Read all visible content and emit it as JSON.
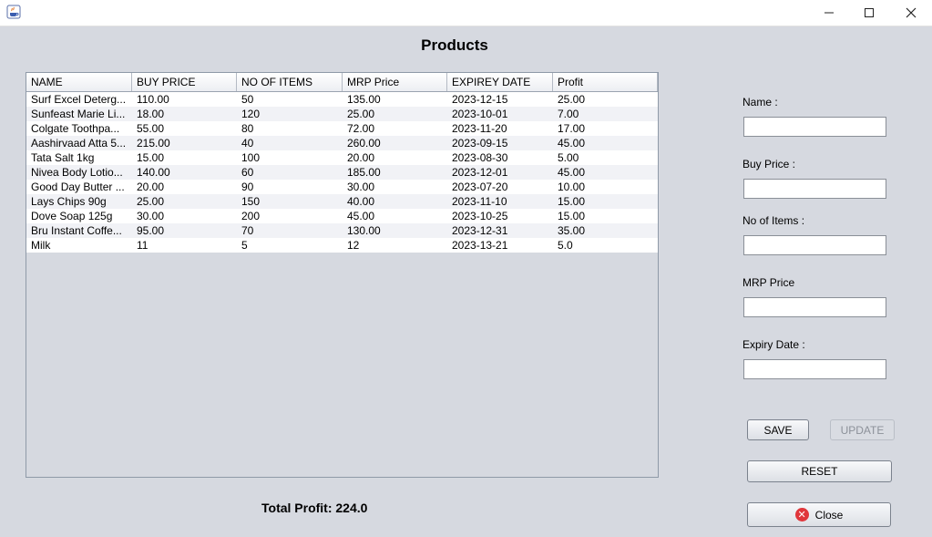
{
  "window": {
    "icon": "java-app-icon"
  },
  "title": "Products",
  "table": {
    "columns": [
      "NAME",
      "BUY PRICE",
      "NO OF ITEMS",
      "MRP Price",
      "EXPIREY DATE",
      "Profit"
    ],
    "rows": [
      [
        "Surf Excel Deterg...",
        "110.00",
        "50",
        "135.00",
        "2023-12-15",
        "25.00"
      ],
      [
        "Sunfeast Marie Li...",
        "18.00",
        "120",
        "25.00",
        "2023-10-01",
        "7.00"
      ],
      [
        "Colgate Toothpa...",
        "55.00",
        "80",
        "72.00",
        "2023-11-20",
        "17.00"
      ],
      [
        "Aashirvaad Atta 5...",
        "215.00",
        "40",
        "260.00",
        "2023-09-15",
        "45.00"
      ],
      [
        "Tata Salt 1kg",
        "15.00",
        "100",
        "20.00",
        "2023-08-30",
        "5.00"
      ],
      [
        "Nivea Body Lotio...",
        "140.00",
        "60",
        "185.00",
        "2023-12-01",
        "45.00"
      ],
      [
        "Good Day Butter ...",
        "20.00",
        "90",
        "30.00",
        "2023-07-20",
        "10.00"
      ],
      [
        "Lays Chips 90g",
        "25.00",
        "150",
        "40.00",
        "2023-11-10",
        "15.00"
      ],
      [
        "Dove Soap 125g",
        "30.00",
        "200",
        "45.00",
        "2023-10-25",
        "15.00"
      ],
      [
        "Bru Instant Coffe...",
        "95.00",
        "70",
        "130.00",
        "2023-12-31",
        "35.00"
      ],
      [
        "Milk",
        "11",
        "5",
        "12",
        "2023-13-21",
        "5.0"
      ]
    ]
  },
  "total_profit": "Total Profit: 224.0",
  "form": {
    "name_label": "Name :",
    "buy_price_label": "Buy Price :",
    "no_of_items_label": "No of Items :",
    "mrp_price_label": "MRP Price",
    "expiry_date_label": "Expiry Date :",
    "name_value": "",
    "buy_price_value": "",
    "no_of_items_value": "",
    "mrp_price_value": "",
    "expiry_date_value": ""
  },
  "buttons": {
    "save": "SAVE",
    "update": "UPDATE",
    "reset": "RESET",
    "close": "Close"
  }
}
